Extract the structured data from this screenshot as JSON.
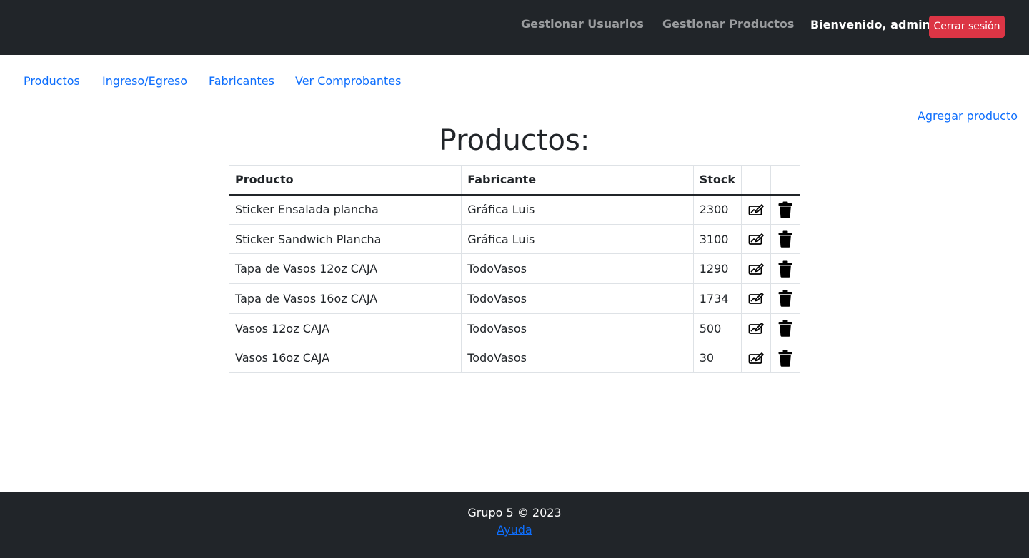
{
  "navbar": {
    "links": [
      "Gestionar Usuarios",
      "Gestionar Productos"
    ],
    "welcome": "Bienvenido, admin |",
    "logout_label": "Cerrar sesión"
  },
  "tabs": [
    "Productos",
    "Ingreso/Egreso",
    "Fabricantes",
    "Ver Comprobantes"
  ],
  "add_product_label": "Agregar producto",
  "page_title": "Productos:",
  "table": {
    "headers": [
      "Producto",
      "Fabricante",
      "Stock"
    ],
    "rows": [
      {
        "producto": "Sticker Ensalada plancha",
        "fabricante": "Gráfica Luis",
        "stock": "2300"
      },
      {
        "producto": "Sticker Sandwich Plancha",
        "fabricante": "Gráfica Luis",
        "stock": "3100"
      },
      {
        "producto": "Tapa de Vasos 12oz CAJA",
        "fabricante": "TodoVasos",
        "stock": "1290"
      },
      {
        "producto": "Tapa de Vasos 16oz CAJA",
        "fabricante": "TodoVasos",
        "stock": "1734"
      },
      {
        "producto": "Vasos 12oz CAJA",
        "fabricante": "TodoVasos",
        "stock": "500"
      },
      {
        "producto": "Vasos 16oz CAJA",
        "fabricante": "TodoVasos",
        "stock": "30"
      }
    ],
    "row_icons": [
      "edit-icon",
      "trash-icon"
    ]
  },
  "footer": {
    "text": "Grupo 5 © 2023",
    "help_label": "Ayuda"
  },
  "colors": {
    "dark": "#212529",
    "link": "#0d6efd",
    "danger": "#dc3545"
  }
}
